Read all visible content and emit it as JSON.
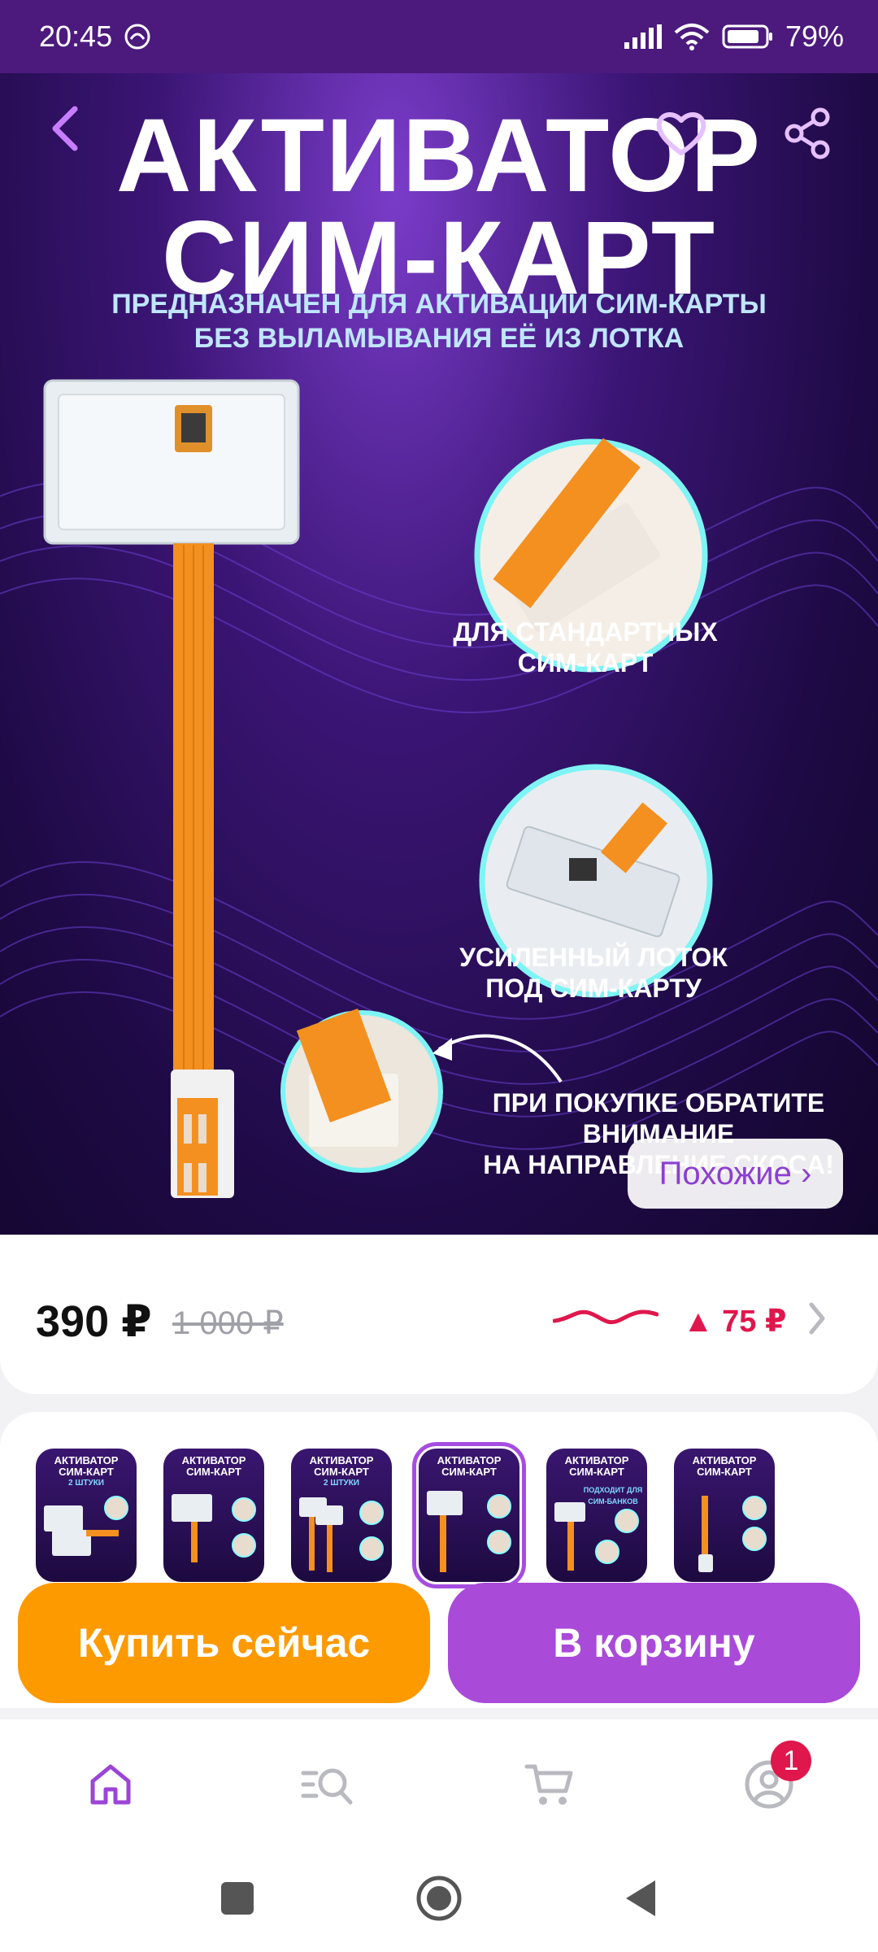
{
  "status_bar": {
    "time": "20:45",
    "battery": "79%"
  },
  "hero": {
    "title_line1": "АКТИВАТОР",
    "title_line2": "СИМ-КАРТ",
    "subtitle_line1": "ПРЕДНАЗНАЧЕН ДЛЯ АКТИВАЦИИ СИМ-КАРТЫ",
    "subtitle_line2": "БЕЗ ВЫЛАМЫВАНИЯ ЕЁ ИЗ ЛОТКА",
    "caption1_line1": "ДЛЯ СТАНДАРТНЫХ",
    "caption1_line2": "СИМ-КАРТ",
    "caption2_line1": "УСИЛЕННЫЙ ЛОТОК",
    "caption2_line2": "ПОД СИМ-КАРТУ",
    "caption3_line1": "ПРИ ПОКУПКЕ ОБРАТИТЕ",
    "caption3_line2": "ВНИМАНИЕ",
    "caption3_line3": "НА НАПРАВЛЕНИЕ СКОСА!",
    "similar_label": "Похожие ›"
  },
  "price": {
    "current": "390 ₽",
    "old": "1 000 ₽",
    "delta": "▲ 75 ₽"
  },
  "thumbnails": {
    "title1": "АКТИВАТОР",
    "title2": "СИМ-КАРТ",
    "tag_two": "2 ШТУКИ",
    "tag_banks": "ПОДХОДИТ ДЛЯ СИМ-БАНКОВ",
    "selected_index": 3
  },
  "actions": {
    "buy_now": "Купить сейчас",
    "add_to_cart": "В корзину"
  },
  "bottom_nav": {
    "items": [
      "home-icon",
      "catalog-search-icon",
      "cart-icon",
      "profile-icon"
    ],
    "active": "home-icon",
    "profile_badge": "1"
  },
  "colors": {
    "status_bar": "#4c1a7d",
    "accent_purple": "#a94ad9",
    "buy_orange": "#fd9a00",
    "price_red": "#e0174c"
  }
}
